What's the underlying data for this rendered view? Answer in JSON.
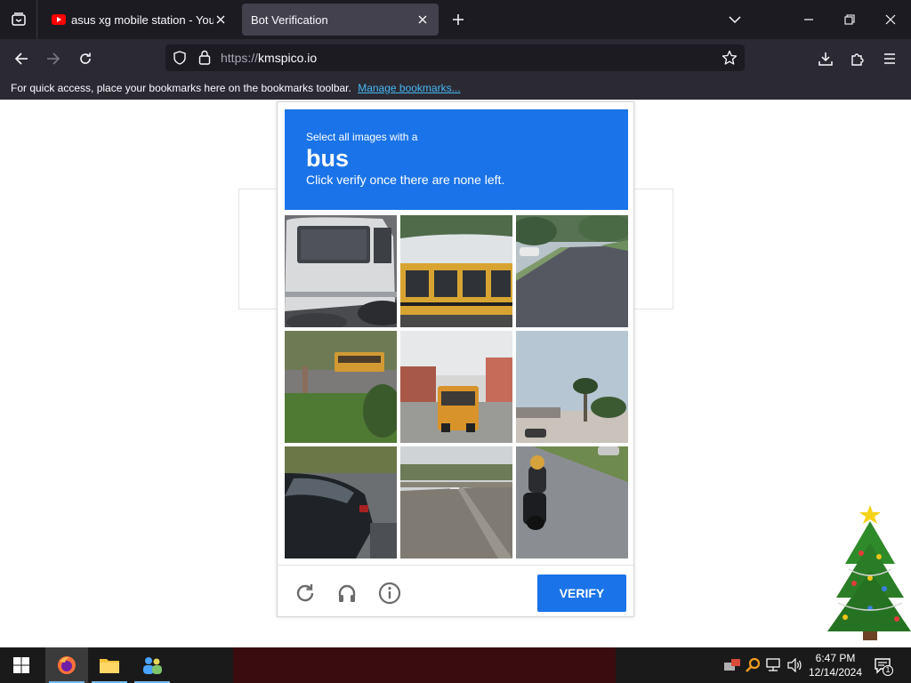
{
  "browser": {
    "tabs": [
      {
        "title": "asus xg mobile station - YouTube",
        "active": false
      },
      {
        "title": "Bot Verification",
        "active": true
      }
    ],
    "url": {
      "protocol": "https://",
      "host": "kmspico.io"
    },
    "bookmarks_bar": {
      "message": "For quick access, place your bookmarks here on the bookmarks toolbar.",
      "link": "Manage bookmarks..."
    },
    "icons": [
      "tab-list-icon",
      "youtube-icon",
      "close-icon",
      "new-tab-icon",
      "chevron-down-icon",
      "minimize-icon",
      "restore-icon",
      "close-window-icon",
      "back-icon",
      "forward-icon",
      "reload-icon",
      "shield-icon",
      "lock-icon",
      "star-icon",
      "download-icon",
      "extensions-icon",
      "menu-icon"
    ]
  },
  "captcha": {
    "prompt": "Select all images with a",
    "target": "bus",
    "instruction": "Click verify once there are none left.",
    "verify_label": "VERIFY",
    "tiles": [
      {
        "subject": "white van"
      },
      {
        "subject": "school bus"
      },
      {
        "subject": "street"
      },
      {
        "subject": "bus in distance"
      },
      {
        "subject": "school bus on street"
      },
      {
        "subject": "palm tree street"
      },
      {
        "subject": "black car"
      },
      {
        "subject": "road"
      },
      {
        "subject": "motorcycle rider"
      }
    ],
    "footer_icons": [
      "reload-icon",
      "headphones-icon",
      "info-icon"
    ]
  },
  "taskbar": {
    "apps": [
      "firefox-icon",
      "file-explorer-icon",
      "people-app-icon"
    ],
    "tray_icons": [
      "network-app-icon",
      "search-icon",
      "network-icon",
      "volume-icon"
    ],
    "time": "6:47 PM",
    "date": "12/14/2024",
    "notification_count": "1"
  },
  "colors": {
    "captcha_blue": "#1a73e8",
    "tab_active": "#42414d",
    "chrome_dark": "#1c1b22",
    "toolbar": "#2b2a33",
    "link": "#45b7f5"
  }
}
